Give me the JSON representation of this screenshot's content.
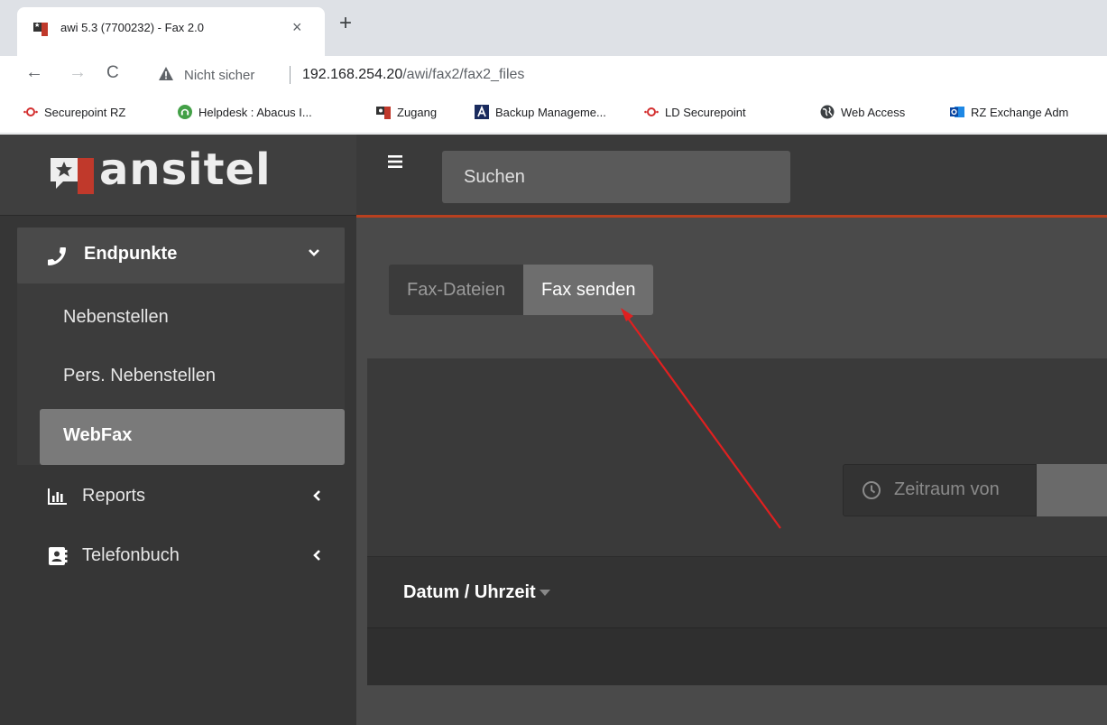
{
  "browser": {
    "tab": {
      "title": "awi 5.3 (7700232) - Fax 2.0",
      "close": "×"
    },
    "new_tab": "+",
    "nav": {
      "back": "←",
      "forward": "→",
      "reload": "C"
    },
    "address": {
      "security": "Nicht sicher",
      "host": "192.168.254.20",
      "path": "/awi/fax2/fax2_files"
    },
    "bookmarks": [
      {
        "label": "Securepoint RZ",
        "icon": "securepoint-icon"
      },
      {
        "label": "Helpdesk : Abacus I...",
        "icon": "helpdesk-icon"
      },
      {
        "label": "Zugang",
        "icon": "ansitel-icon"
      },
      {
        "label": "Backup Manageme...",
        "icon": "acronis-icon"
      },
      {
        "label": "LD Securepoint",
        "icon": "securepoint-icon"
      },
      {
        "label": "Web Access",
        "icon": "globe-icon"
      },
      {
        "label": "RZ Exchange Adm",
        "icon": "outlook-icon"
      }
    ]
  },
  "app": {
    "brand": "ansitel",
    "search": {
      "placeholder": "Suchen"
    },
    "sidebar": {
      "group": {
        "label": "Endpunkte",
        "items": [
          "Nebenstellen",
          "Pers. Nebenstellen",
          "WebFax"
        ],
        "active": "WebFax"
      },
      "items": [
        {
          "label": "Reports"
        },
        {
          "label": "Telefonbuch"
        }
      ]
    },
    "tabs": [
      {
        "label": "Fax-Dateien",
        "active": false
      },
      {
        "label": "Fax senden",
        "active": true
      }
    ],
    "filter": {
      "label": "Zeitraum von"
    },
    "table": {
      "columns": [
        {
          "label": "Datum / Uhrzeit"
        }
      ]
    }
  },
  "colors": {
    "accent": "#b8401f",
    "annotation_arrow": "#e02020",
    "sidebar_bg": "#363636",
    "content_bg": "#4a4a4a"
  }
}
